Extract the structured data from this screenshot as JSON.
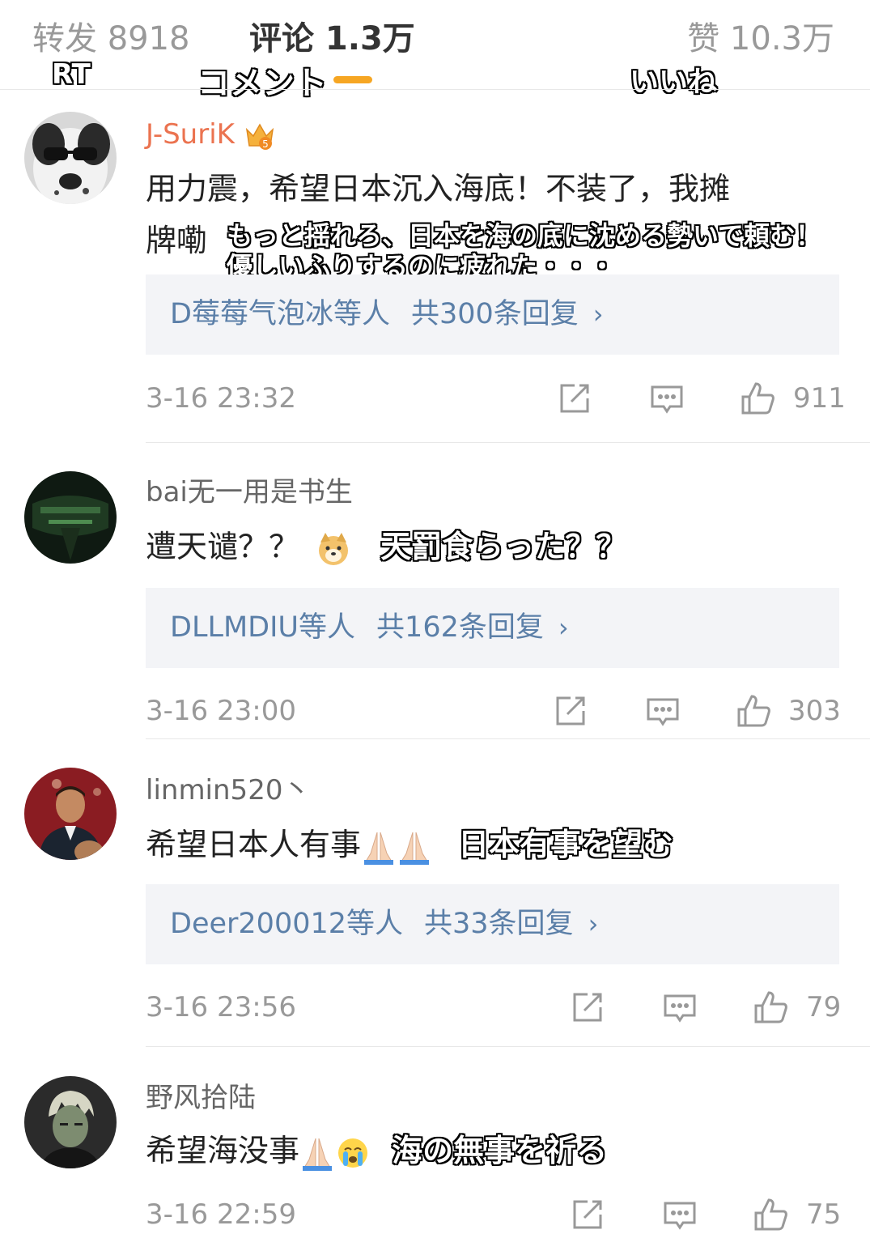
{
  "tabs": {
    "repost": "转发 8918",
    "comments": "评论 1.3万",
    "likes": "赞 10.3万",
    "accent_color": "#f6a623"
  },
  "overlay_labels": {
    "repost": "RT",
    "comments": "コメント",
    "likes": "いいね"
  },
  "comments": [
    {
      "username": "J-SuriK",
      "badge_icon": "crown-level-5-icon",
      "badge_level": "5",
      "text_line1": "用力震，希望日本沉入海底！不装了，我摊",
      "text_line2": "牌嘞",
      "translation_line1": "もっと揺れろ、日本を海の底に沈める勢いで頼む！",
      "translation_line2": "優しいふりするのに疲れた・・・",
      "reply_users": "D莓莓气泡冰等人",
      "reply_count": "共300条回复",
      "time": "3-16 23:32",
      "likes": "911"
    },
    {
      "username": "bai无一用是书生",
      "text": "遭天谴？？",
      "emoji": "doge-icon",
      "translation": "天罰食らった？？",
      "reply_users": "DLLMDIU等人",
      "reply_count": "共162条回复",
      "time": "3-16 23:00",
      "likes": "303"
    },
    {
      "username": "linmin520丶",
      "text": "希望日本人有事",
      "emoji": "praying-hands-icon",
      "translation": "日本有事を望む",
      "reply_users": "Deer200012等人",
      "reply_count": "共33条回复",
      "time": "3-16 23:56",
      "likes": "79"
    },
    {
      "username": "野风拾陆",
      "text": "希望海没事",
      "emoji": "praying-hands-icon",
      "emoji2": "crying-face-icon",
      "translation": "海の無事を祈る",
      "time": "3-16 22:59",
      "likes": "75"
    }
  ],
  "colors": {
    "vip_name": "#eb7350",
    "reply_link": "#5b7fa8",
    "reply_bg": "#f3f4f7",
    "muted": "#999999"
  }
}
